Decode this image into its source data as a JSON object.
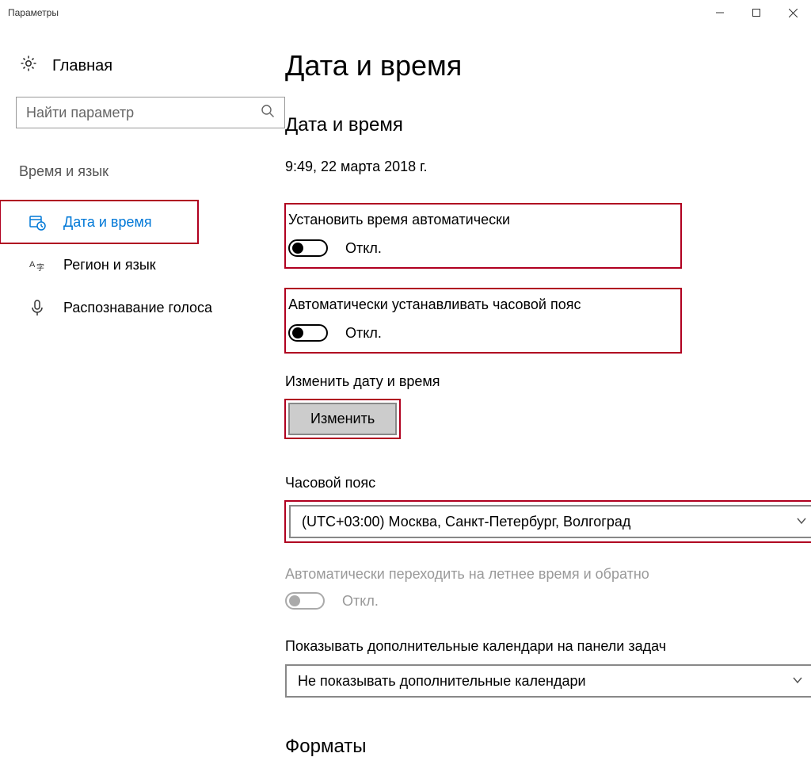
{
  "window": {
    "title": "Параметры"
  },
  "sidebar": {
    "home": "Главная",
    "search_placeholder": "Найти параметр",
    "group_heading": "Время и язык",
    "items": [
      {
        "label": "Дата и время"
      },
      {
        "label": "Регион и язык"
      },
      {
        "label": "Распознавание голоса"
      }
    ]
  },
  "main": {
    "title": "Дата и время",
    "section_title": "Дата и время",
    "current_datetime": "9:49, 22 марта 2018 г.",
    "auto_time": {
      "label": "Установить время автоматически",
      "state": "Откл."
    },
    "auto_tz": {
      "label": "Автоматически устанавливать часовой пояс",
      "state": "Откл."
    },
    "change_label": "Изменить дату и время",
    "change_button": "Изменить",
    "tz_label": "Часовой пояс",
    "tz_value": "(UTC+03:00) Москва, Санкт-Петербург, Волгоград",
    "dst_label": "Автоматически переходить на летнее время и обратно",
    "dst_state": "Откл.",
    "extra_cal_label": "Показывать дополнительные календари на панели задач",
    "extra_cal_value": "Не показывать дополнительные календари",
    "formats_heading": "Форматы"
  }
}
